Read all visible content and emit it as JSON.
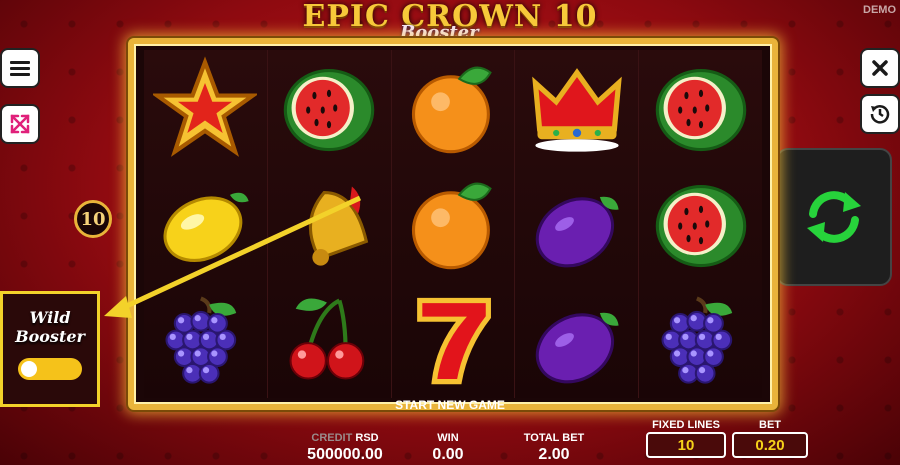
{
  "game": {
    "title": "EPIC CROWN 10",
    "subtitle": "Booster",
    "mode_badge": "DEMO"
  },
  "reels": [
    [
      "star",
      "lemon",
      "grapes"
    ],
    [
      "watermelon",
      "bell",
      "cherries"
    ],
    [
      "orange",
      "orange",
      "seven"
    ],
    [
      "crown",
      "plum",
      "plum"
    ],
    [
      "watermelon",
      "watermelon",
      "grapes"
    ]
  ],
  "left_controls": {
    "menu_icon": "menu-icon",
    "fullscreen_icon": "fullscreen-icon"
  },
  "right_controls": {
    "close_icon": "close-icon",
    "history_icon": "history-icon",
    "spin_icon": "spin-icon"
  },
  "lines_badge": "10",
  "wild_booster": {
    "label_line1": "Wild",
    "label_line2": "Booster",
    "enabled": false
  },
  "message": "START NEW GAME",
  "footer": {
    "credit_label": "CREDIT",
    "currency": "RSD",
    "credit_value": "500000.00",
    "win_label": "WIN",
    "win_value": "0.00",
    "total_bet_label": "TOTAL BET",
    "total_bet_value": "2.00",
    "fixed_lines_label": "FIXED LINES",
    "fixed_lines_value": "10",
    "bet_label": "BET",
    "bet_value": "0.20"
  },
  "colors": {
    "accent_gold": "#e9b43a",
    "spin_green": "#27d33b",
    "toggle_yellow": "#f5c21a",
    "background_red": "#c8161c"
  }
}
